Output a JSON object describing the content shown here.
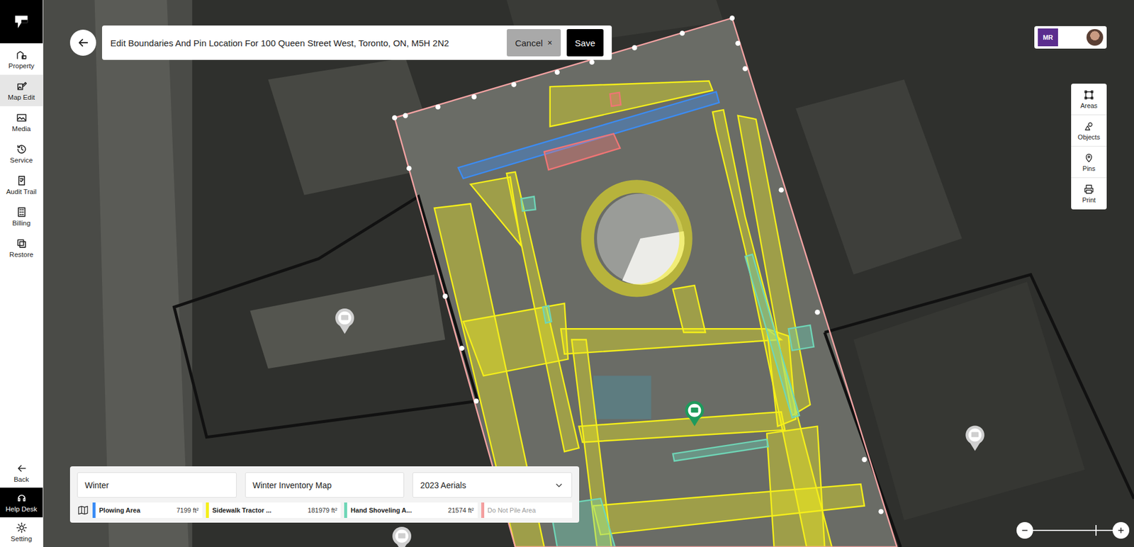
{
  "page": {
    "title": "Edit Boundaries And Pin Location For 100 Queen Street West, Toronto, ON, M5H 2N2"
  },
  "actions": {
    "cancel": {
      "label": "Cancel",
      "icon": "×"
    },
    "save": {
      "label": "Save"
    }
  },
  "sidebar": {
    "items": [
      {
        "label": "Property",
        "selected": false
      },
      {
        "label": "Map Edit",
        "selected": true
      },
      {
        "label": "Media",
        "selected": false
      },
      {
        "label": "Service",
        "selected": false
      },
      {
        "label": "Audit Trail",
        "selected": false
      },
      {
        "label": "Billing",
        "selected": false
      },
      {
        "label": "Restore",
        "selected": false
      }
    ],
    "bottom": [
      {
        "label": "Back",
        "highlighted": false
      },
      {
        "label": "Help Desk",
        "highlighted": true
      },
      {
        "label": "Setting",
        "highlighted": false
      }
    ]
  },
  "account": {
    "org_badge": "MR"
  },
  "tools": [
    {
      "label": "Areas"
    },
    {
      "label": "Objects"
    },
    {
      "label": "Pins"
    },
    {
      "label": "Print"
    }
  ],
  "map_settings": {
    "season": "Winter",
    "map": "Winter Inventory Map",
    "imagery": "2023 Aerials"
  },
  "legend": [
    {
      "name": "Plowing Area",
      "area": "7199 ft²",
      "color": "#3b8cf5",
      "enabled": true
    },
    {
      "name": "Sidewalk Tractor ...",
      "area": "181979 ft²",
      "color": "#f5ef1a",
      "enabled": true
    },
    {
      "name": "Hand Shoveling A...",
      "area": "21574 ft²",
      "color": "#6fd6b7",
      "enabled": true
    },
    {
      "name": "Do Not Pile Area",
      "color": "#f07575",
      "enabled": false
    }
  ],
  "pins": [
    {
      "color": "#cfcfcf"
    },
    {
      "color": "#cfcfcf"
    },
    {
      "color": "#cfcfcf"
    },
    {
      "color": "#1e9a5c"
    }
  ],
  "zoom": {
    "level": 0.78
  }
}
